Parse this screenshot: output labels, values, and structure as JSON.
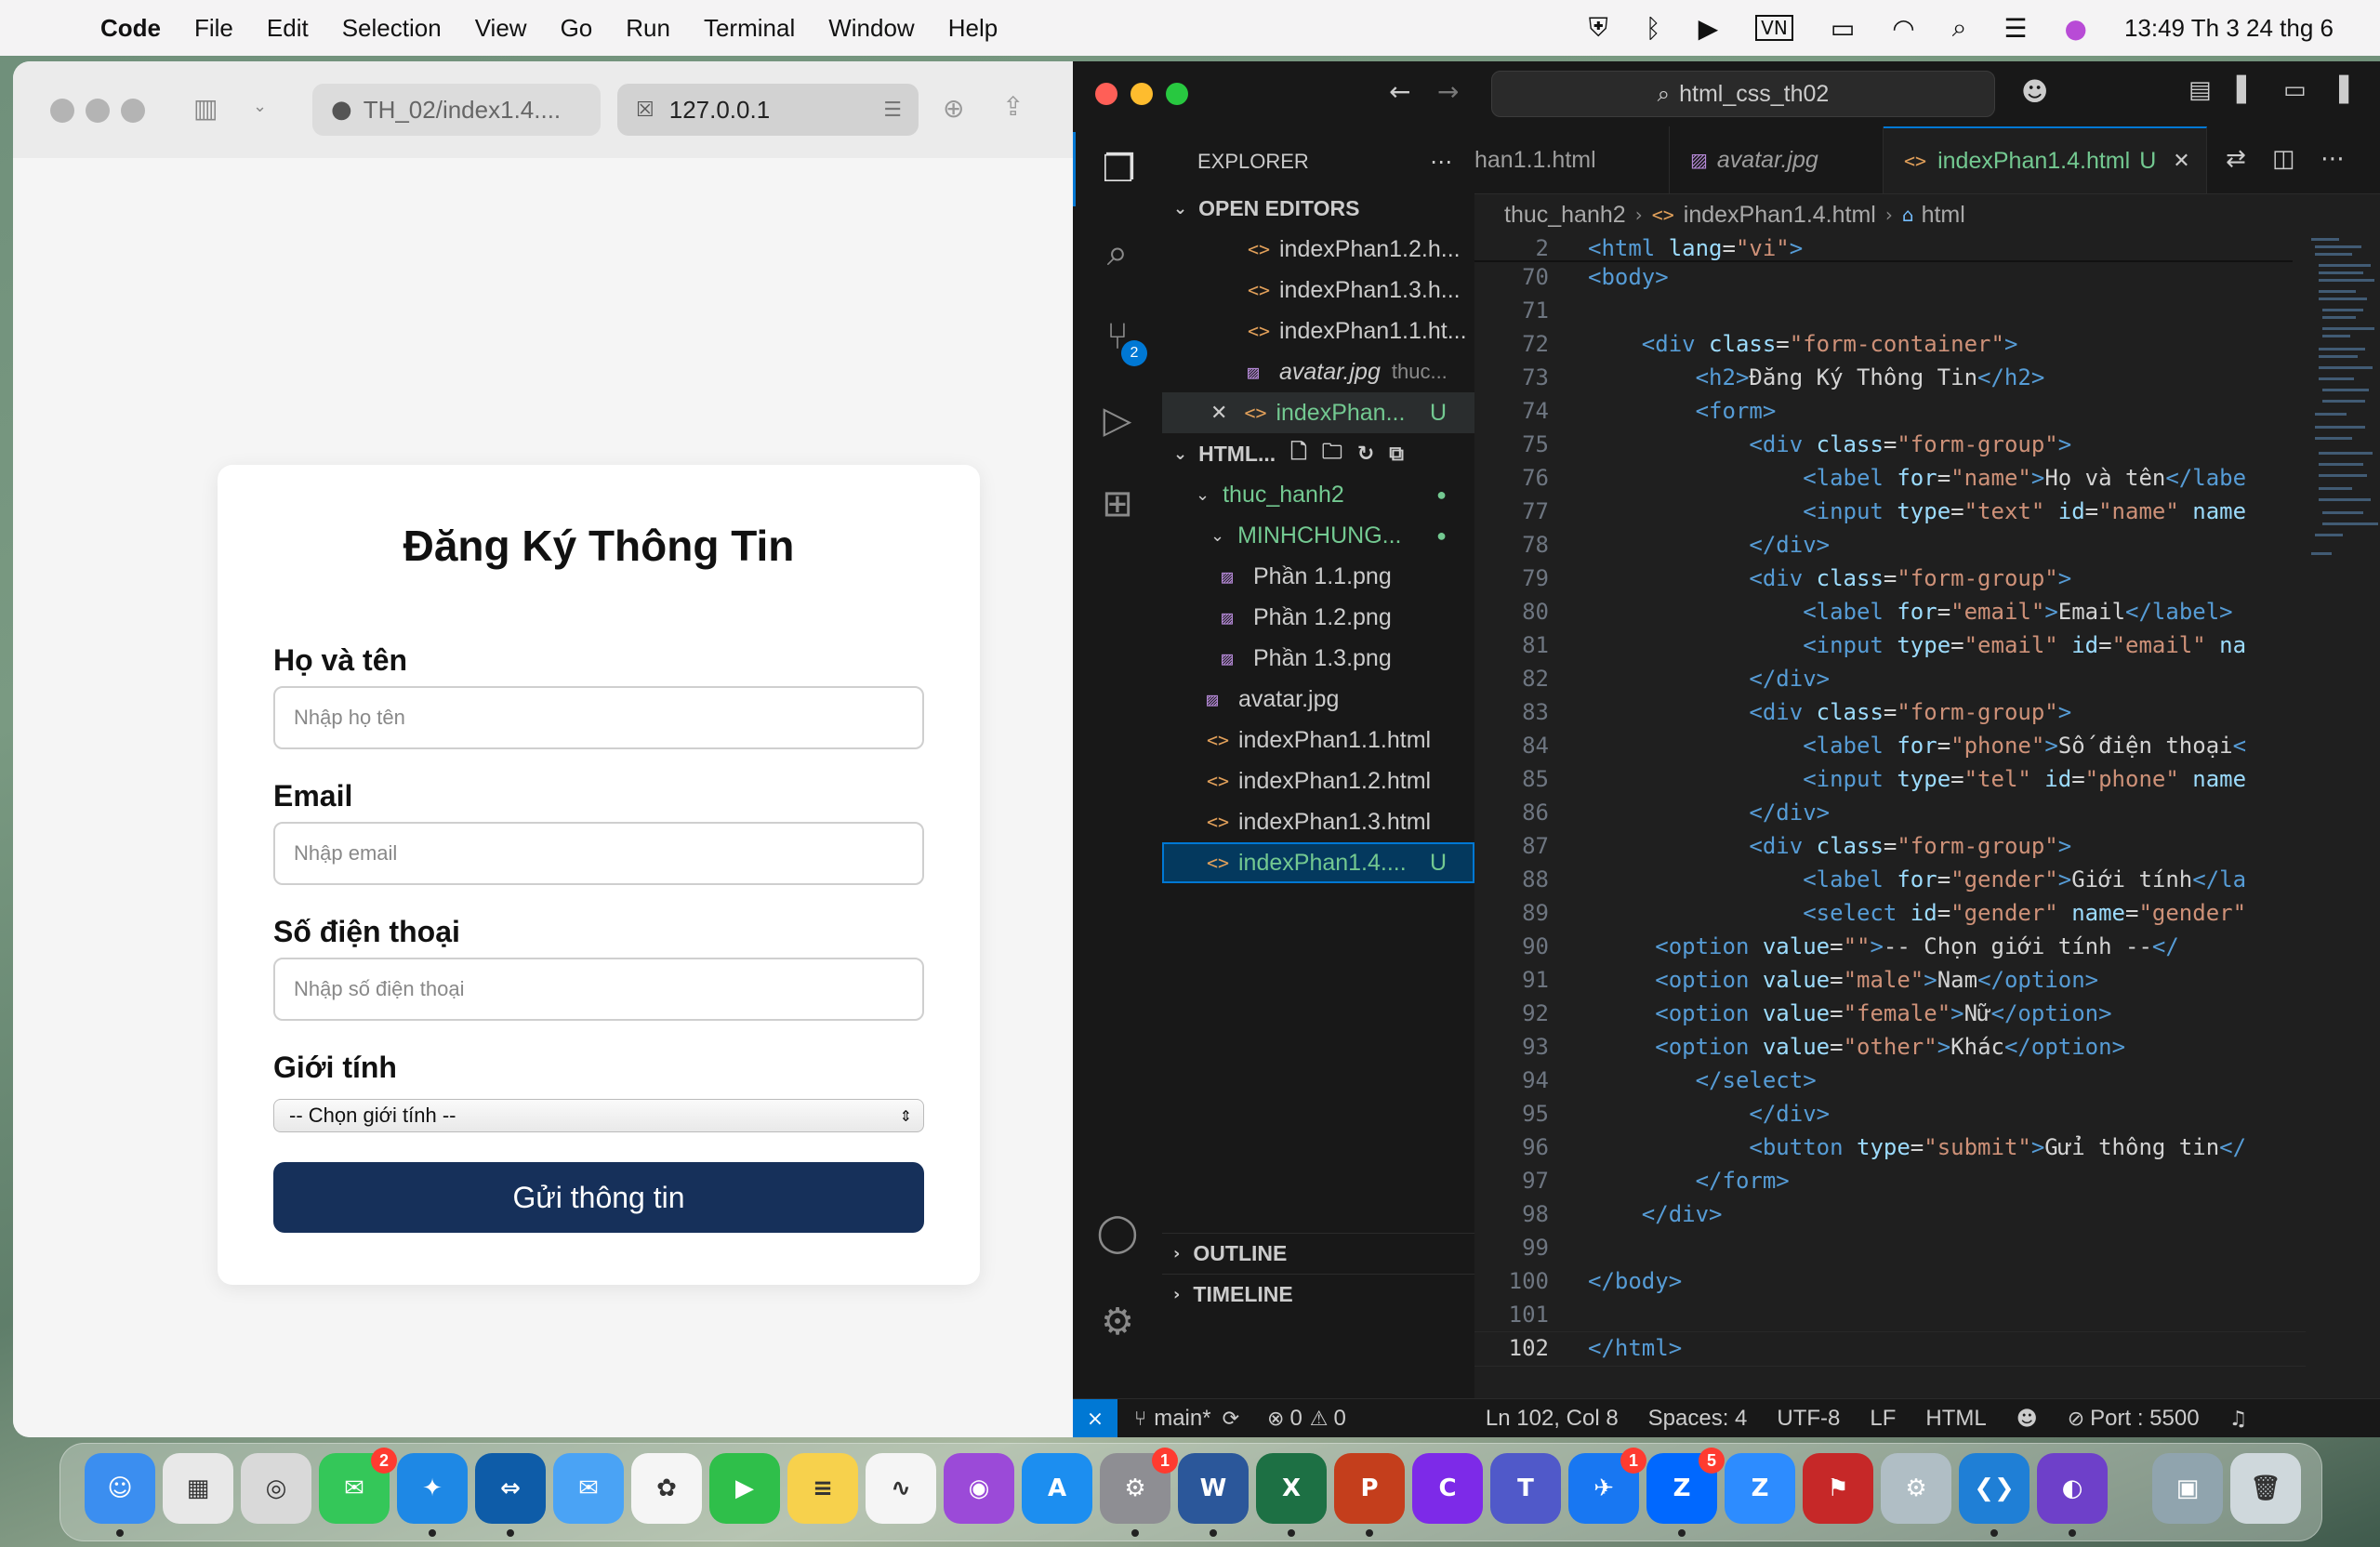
{
  "menubar": {
    "app_name": "Code",
    "items": [
      "File",
      "Edit",
      "Selection",
      "View",
      "Go",
      "Run",
      "Terminal",
      "Window",
      "Help"
    ],
    "clock": "13:49 Th 3 24 thg 6"
  },
  "browser": {
    "tab1_label": "TH_02/index1.4....",
    "tab2_label": "127.0.0.1"
  },
  "form": {
    "title": "Đăng Ký Thông Tin",
    "name_label": "Họ và tên",
    "name_placeholder": "Nhập họ tên",
    "email_label": "Email",
    "email_placeholder": "Nhập email",
    "phone_label": "Số điện thoại",
    "phone_placeholder": "Nhập số điện thoại",
    "gender_label": "Giới tính",
    "gender_selected": "-- Chọn giới tính --",
    "submit_label": "Gửi thông tin"
  },
  "vscode": {
    "search_text": "html_css_th02",
    "explorer_title": "EXPLORER",
    "open_editors_title": "OPEN EDITORS",
    "open_editors": [
      {
        "name": "indexPhan1.2.h...",
        "icon": "html-icon"
      },
      {
        "name": "indexPhan1.3.h...",
        "icon": "html-icon"
      },
      {
        "name": "indexPhan1.1.ht...",
        "icon": "html-icon"
      },
      {
        "name": "avatar.jpg",
        "sub": "thuc...",
        "icon": "image-icon"
      },
      {
        "name": "indexPhan...",
        "badge": "U",
        "icon": "html-icon"
      }
    ],
    "workspace_title": "HTML...",
    "tree": {
      "folder1": "thuc_hanh2",
      "folder2": "MINHCHUNG...",
      "files": [
        "Phần 1.1.png",
        "Phần 1.2.png",
        "Phần 1.3.png",
        "avatar.jpg",
        "indexPhan1.1.html",
        "indexPhan1.2.html",
        "indexPhan1.3.html",
        "indexPhan1.4...."
      ],
      "selected_badge": "U"
    },
    "outline_title": "OUTLINE",
    "timeline_title": "TIMELINE",
    "tabs": [
      {
        "label": "han1.1.html"
      },
      {
        "label": "avatar.jpg"
      },
      {
        "label": "indexPhan1.4.html",
        "badge": "U"
      }
    ],
    "breadcrumb": [
      "thuc_hanh2",
      "indexPhan1.4.html",
      "html"
    ],
    "code_lines": [
      {
        "ln": "2",
        "html": "<span class='tg'>&lt;html</span> <span class='at'>lang</span><span class='tx'>=</span><span class='st'>\"vi\"</span><span class='tg'>&gt;</span>"
      },
      {
        "ln": "70",
        "html": "<span class='tg'>&lt;body&gt;</span>"
      },
      {
        "ln": "71",
        "html": ""
      },
      {
        "ln": "72",
        "html": "    <span class='tg'>&lt;div</span> <span class='at'>class</span><span class='tx'>=</span><span class='st'>\"form-container\"</span><span class='tg'>&gt;</span>"
      },
      {
        "ln": "73",
        "html": "        <span class='tg'>&lt;h2&gt;</span><span class='tx'>Đăng Ký Thông Tin</span><span class='tg'>&lt;/h2&gt;</span>"
      },
      {
        "ln": "74",
        "html": "        <span class='tg'>&lt;form&gt;</span>"
      },
      {
        "ln": "75",
        "html": "            <span class='tg'>&lt;div</span> <span class='at'>class</span><span class='tx'>=</span><span class='st'>\"form-group\"</span><span class='tg'>&gt;</span>"
      },
      {
        "ln": "76",
        "html": "                <span class='tg'>&lt;label</span> <span class='at'>for</span><span class='tx'>=</span><span class='st'>\"name\"</span><span class='tg'>&gt;</span><span class='tx'>Họ và tên</span><span class='tg'>&lt;/labe</span>"
      },
      {
        "ln": "77",
        "html": "                <span class='tg'>&lt;input</span> <span class='at'>type</span><span class='tx'>=</span><span class='st'>\"text\"</span> <span class='at'>id</span><span class='tx'>=</span><span class='st'>\"name\"</span> <span class='at'>name</span>"
      },
      {
        "ln": "78",
        "html": "            <span class='tg'>&lt;/div&gt;</span>"
      },
      {
        "ln": "79",
        "html": "            <span class='tg'>&lt;div</span> <span class='at'>class</span><span class='tx'>=</span><span class='st'>\"form-group\"</span><span class='tg'>&gt;</span>"
      },
      {
        "ln": "80",
        "html": "                <span class='tg'>&lt;label</span> <span class='at'>for</span><span class='tx'>=</span><span class='st'>\"email\"</span><span class='tg'>&gt;</span><span class='tx'>Email</span><span class='tg'>&lt;/label&gt;</span>"
      },
      {
        "ln": "81",
        "html": "                <span class='tg'>&lt;input</span> <span class='at'>type</span><span class='tx'>=</span><span class='st'>\"email\"</span> <span class='at'>id</span><span class='tx'>=</span><span class='st'>\"email\"</span> <span class='at'>na</span>"
      },
      {
        "ln": "82",
        "html": "            <span class='tg'>&lt;/div&gt;</span>"
      },
      {
        "ln": "83",
        "html": "            <span class='tg'>&lt;div</span> <span class='at'>class</span><span class='tx'>=</span><span class='st'>\"form-group\"</span><span class='tg'>&gt;</span>"
      },
      {
        "ln": "84",
        "html": "                <span class='tg'>&lt;label</span> <span class='at'>for</span><span class='tx'>=</span><span class='st'>\"phone\"</span><span class='tg'>&gt;</span><span class='tx'>Số điện thoại</span><span class='tg'>&lt;</span>"
      },
      {
        "ln": "85",
        "html": "                <span class='tg'>&lt;input</span> <span class='at'>type</span><span class='tx'>=</span><span class='st'>\"tel\"</span> <span class='at'>id</span><span class='tx'>=</span><span class='st'>\"phone\"</span> <span class='at'>name</span>"
      },
      {
        "ln": "86",
        "html": "            <span class='tg'>&lt;/div&gt;</span>"
      },
      {
        "ln": "87",
        "html": "            <span class='tg'>&lt;div</span> <span class='at'>class</span><span class='tx'>=</span><span class='st'>\"form-group\"</span><span class='tg'>&gt;</span>"
      },
      {
        "ln": "88",
        "html": "                <span class='tg'>&lt;label</span> <span class='at'>for</span><span class='tx'>=</span><span class='st'>\"gender\"</span><span class='tg'>&gt;</span><span class='tx'>Giới tính</span><span class='tg'>&lt;/la</span>"
      },
      {
        "ln": "89",
        "html": "                <span class='tg'>&lt;select</span> <span class='at'>id</span><span class='tx'>=</span><span class='st'>\"gender\"</span> <span class='at'>name</span><span class='tx'>=</span><span class='st'>\"gender\"</span>"
      },
      {
        "ln": "90",
        "html": "     <span class='tg'>&lt;option</span> <span class='at'>value</span><span class='tx'>=</span><span class='st'>\"\"</span><span class='tg'>&gt;</span><span class='tx'>-- Chọn giới tính --</span><span class='tg'>&lt;/</span>"
      },
      {
        "ln": "91",
        "html": "     <span class='tg'>&lt;option</span> <span class='at'>value</span><span class='tx'>=</span><span class='st'>\"male\"</span><span class='tg'>&gt;</span><span class='tx'>Nam</span><span class='tg'>&lt;/option&gt;</span>"
      },
      {
        "ln": "92",
        "html": "     <span class='tg'>&lt;option</span> <span class='at'>value</span><span class='tx'>=</span><span class='st'>\"female\"</span><span class='tg'>&gt;</span><span class='tx'>Nữ</span><span class='tg'>&lt;/option&gt;</span>"
      },
      {
        "ln": "93",
        "html": "     <span class='tg'>&lt;option</span> <span class='at'>value</span><span class='tx'>=</span><span class='st'>\"other\"</span><span class='tg'>&gt;</span><span class='tx'>Khác</span><span class='tg'>&lt;/option&gt;</span>"
      },
      {
        "ln": "94",
        "html": "        <span class='tg'>&lt;/select&gt;</span>"
      },
      {
        "ln": "95",
        "html": "            <span class='tg'>&lt;/div&gt;</span>"
      },
      {
        "ln": "96",
        "html": "            <span class='tg'>&lt;button</span> <span class='at'>type</span><span class='tx'>=</span><span class='st'>\"submit\"</span><span class='tg'>&gt;</span><span class='tx'>Gửi thông tin</span><span class='tg'>&lt;/</span>"
      },
      {
        "ln": "97",
        "html": "        <span class='tg'>&lt;/form&gt;</span>"
      },
      {
        "ln": "98",
        "html": "    <span class='tg'>&lt;/div&gt;</span>"
      },
      {
        "ln": "99",
        "html": ""
      },
      {
        "ln": "100",
        "html": "<span class='tg'>&lt;/body&gt;</span>"
      },
      {
        "ln": "101",
        "html": ""
      },
      {
        "ln": "102",
        "html": "<span class='tg'>&lt;/html&gt;</span>"
      }
    ],
    "status": {
      "branch": "main*",
      "errors": "0",
      "warnings": "0",
      "position": "Ln 102, Col 8",
      "spaces": "Spaces: 4",
      "encoding": "UTF-8",
      "eol": "LF",
      "language": "HTML",
      "port": "Port : 5500"
    },
    "scm_badge": "2"
  },
  "dock": {
    "apps": [
      {
        "name": "finder",
        "color": "#3b8ef0",
        "glyph": "☺"
      },
      {
        "name": "launchpad",
        "color": "#e8e8e8",
        "glyph": "▦"
      },
      {
        "name": "screenshot",
        "color": "#d9d9d9",
        "glyph": "◎"
      },
      {
        "name": "messages",
        "color": "#34c759",
        "glyph": "✉",
        "badge": "2"
      },
      {
        "name": "safari",
        "color": "#1e88e5",
        "glyph": "✦"
      },
      {
        "name": "teamviewer",
        "color": "#0e5ca8",
        "glyph": "⇔"
      },
      {
        "name": "mail",
        "color": "#4aa3f5",
        "glyph": "✉"
      },
      {
        "name": "photos",
        "color": "#f5f5f5",
        "glyph": "✿"
      },
      {
        "name": "facetime",
        "color": "#2fbf4a",
        "glyph": "▶"
      },
      {
        "name": "notes",
        "color": "#f7d14c",
        "glyph": "≡"
      },
      {
        "name": "freeform",
        "color": "#f5f5f5",
        "glyph": "∿"
      },
      {
        "name": "podcasts",
        "color": "#9b4ad8",
        "glyph": "◉"
      },
      {
        "name": "appstore",
        "color": "#1c8ef0",
        "glyph": "A"
      },
      {
        "name": "system-settings",
        "color": "#8e8e93",
        "glyph": "⚙",
        "badge": "1"
      },
      {
        "name": "word",
        "color": "#2b579a",
        "glyph": "W"
      },
      {
        "name": "excel",
        "color": "#1d7044",
        "glyph": "X"
      },
      {
        "name": "powerpoint",
        "color": "#c43e1c",
        "glyph": "P"
      },
      {
        "name": "canva",
        "color": "#7d2ae8",
        "glyph": "C"
      },
      {
        "name": "teams",
        "color": "#5059c9",
        "glyph": "T"
      },
      {
        "name": "messenger",
        "color": "#1877f2",
        "glyph": "✈",
        "badge": "1"
      },
      {
        "name": "zalo",
        "color": "#0068ff",
        "glyph": "Z",
        "badge": "5"
      },
      {
        "name": "zoom",
        "color": "#2d8cff",
        "glyph": "Z"
      },
      {
        "name": "packet-tracer",
        "color": "#c62828",
        "glyph": "⚑"
      },
      {
        "name": "utility",
        "color": "#b0bec5",
        "glyph": "⚙"
      },
      {
        "name": "vscode",
        "color": "#1f7fd6",
        "glyph": "❮❯"
      },
      {
        "name": "github-desktop",
        "color": "#6e40c9",
        "glyph": "◐"
      },
      {
        "name": "preview",
        "color": "#90a4ae",
        "glyph": "▣"
      },
      {
        "name": "trash",
        "color": "#cfd8dc",
        "glyph": "🗑"
      }
    ]
  }
}
